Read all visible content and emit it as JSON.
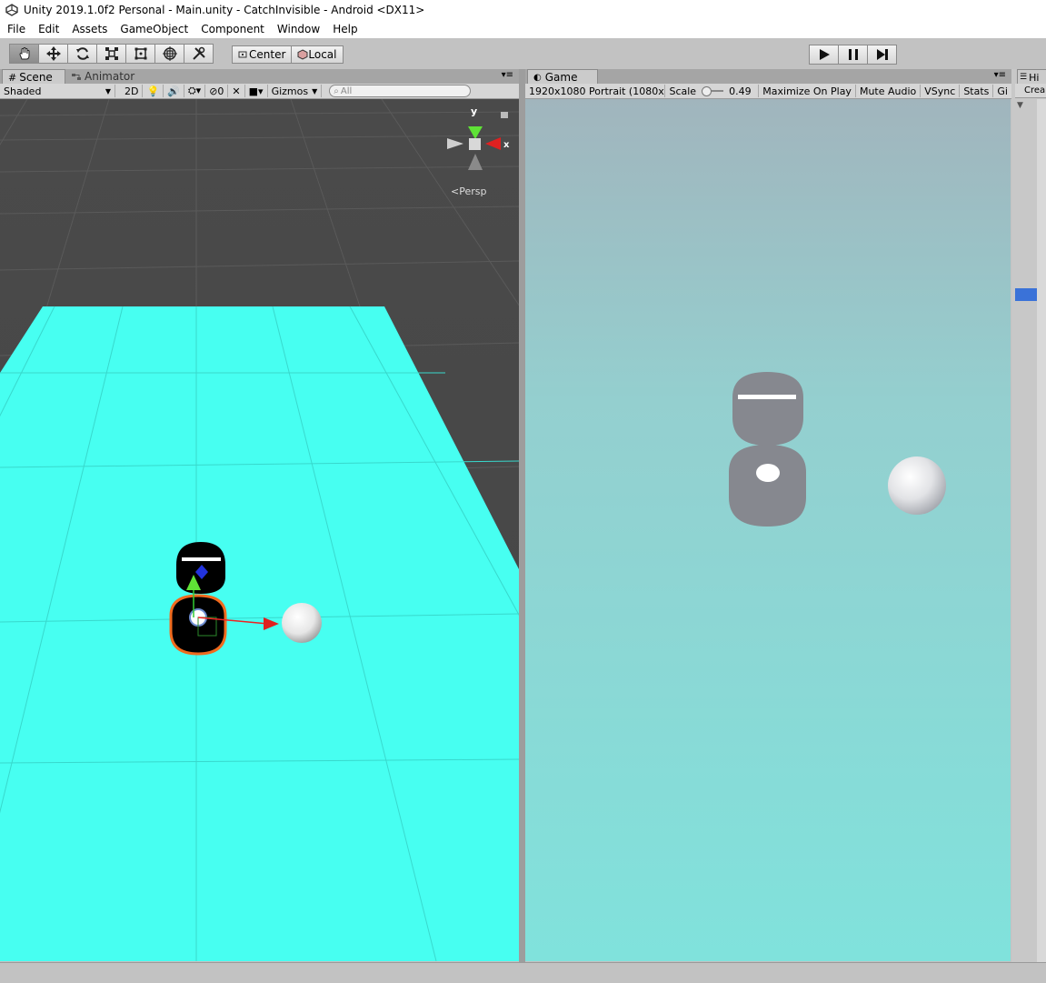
{
  "title": "Unity 2019.1.0f2 Personal - Main.unity - CatchInvisible - Android <DX11>",
  "menu": [
    "File",
    "Edit",
    "Assets",
    "GameObject",
    "Component",
    "Window",
    "Help"
  ],
  "toolbar": {
    "center_label": "Center",
    "local_label": "Local"
  },
  "scene_panel": {
    "tab_scene": "Scene",
    "tab_animator": "Animator",
    "shading_mode": "Shaded",
    "two_d_label": "2D",
    "hidden_count": "0",
    "gizmos_label": "Gizmos",
    "search_placeholder": "All",
    "gizmo_y": "y",
    "gizmo_x": "x",
    "persp_label": "Persp"
  },
  "game_panel": {
    "tab_game": "Game",
    "resolution": "1920x1080 Portrait (1080x",
    "scale_label": "Scale",
    "scale_value": "0.49",
    "maximize_label": "Maximize On Play",
    "mute_label": "Mute Audio",
    "vsync_label": "VSync",
    "stats_label": "Stats",
    "gizmos_label": "Gi"
  },
  "hierarchy_panel": {
    "tab_label": "Hi",
    "create_label": "Crea"
  },
  "colors": {
    "ground": "#47fff1",
    "scene_bg": "#474747",
    "selection": "#f06a1e"
  }
}
